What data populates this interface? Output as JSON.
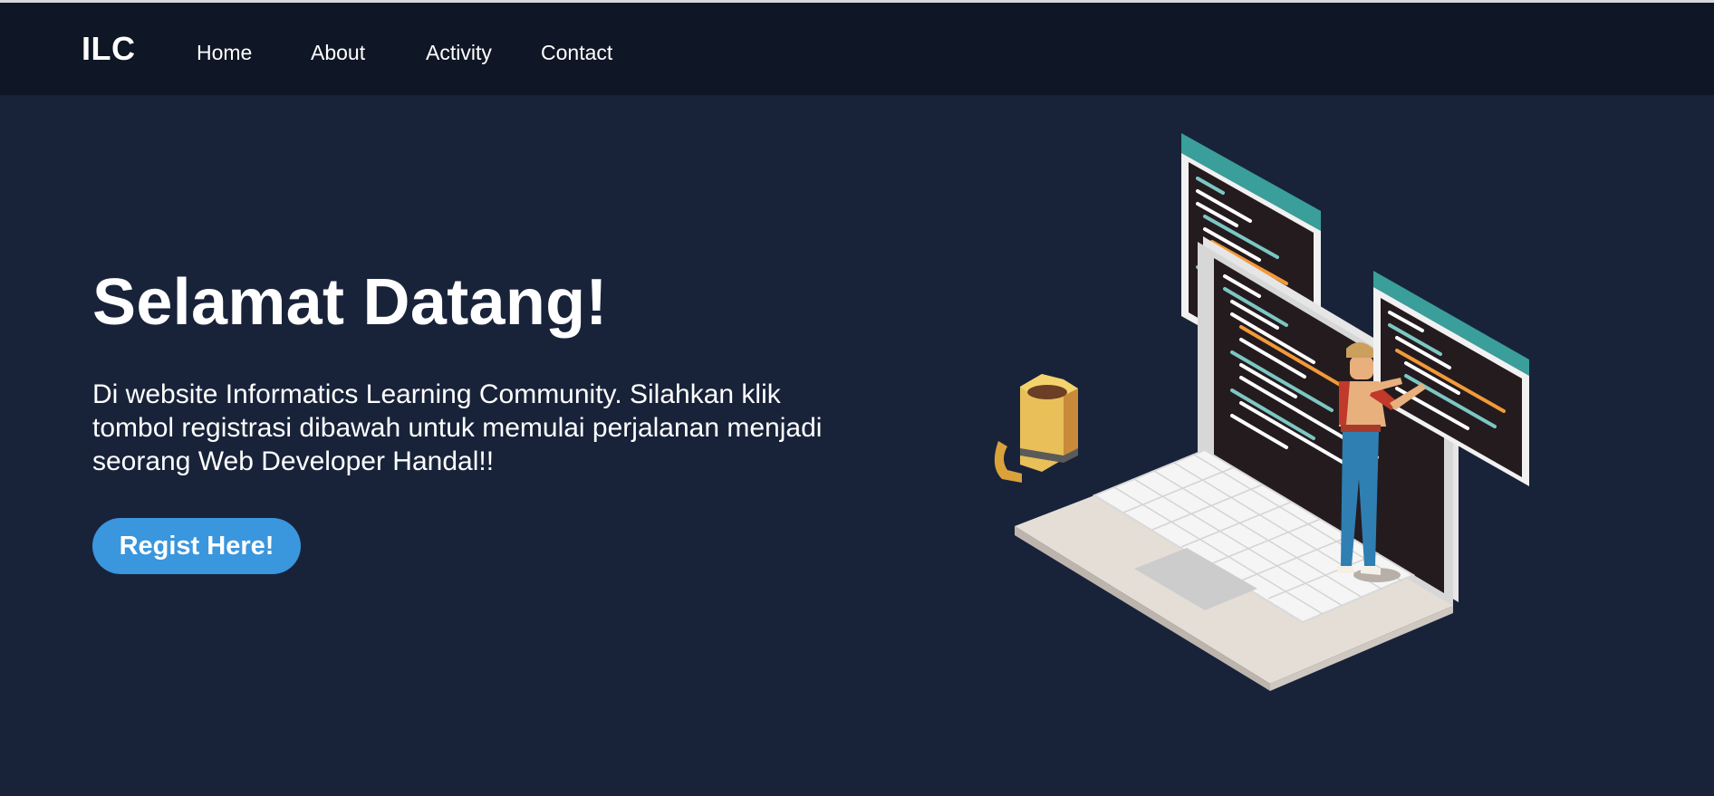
{
  "navbar": {
    "brand": "ILC",
    "links": [
      "Home",
      "About",
      "Activity",
      "Contact"
    ]
  },
  "hero": {
    "title": "Selamat Datang!",
    "description": "Di website Informatics Learning Community. Silahkan klik tombol registrasi dibawah untuk memulai perjalanan menjadi seorang Web Developer Handal!!",
    "cta_label": "Regist Here!"
  },
  "illustration": {
    "icon": "developer-laptop-illustration"
  },
  "colors": {
    "background": "#18233a",
    "navbar": "#0f1625",
    "accent": "#3a96dd",
    "text": "#ffffff"
  }
}
